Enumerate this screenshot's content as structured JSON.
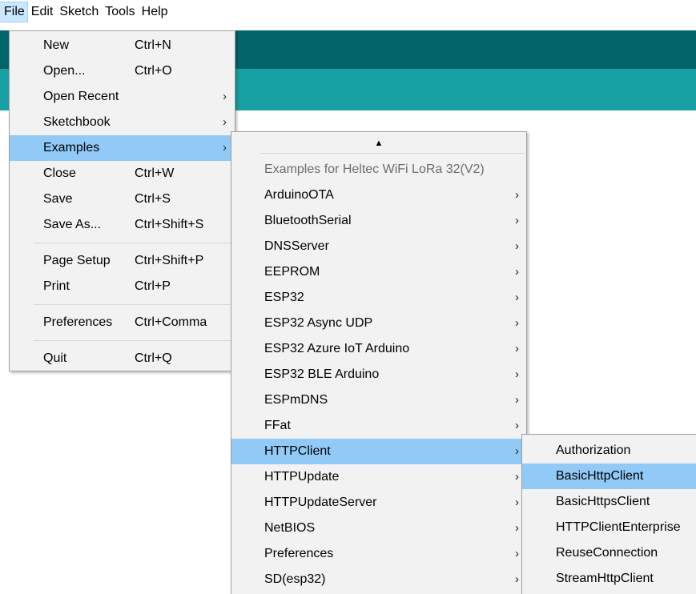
{
  "menubar": {
    "items": [
      "File",
      "Edit",
      "Sketch",
      "Tools",
      "Help"
    ]
  },
  "file_menu": {
    "items": [
      {
        "label": "New",
        "shortcut": "Ctrl+N",
        "arrow": ""
      },
      {
        "label": "Open...",
        "shortcut": "Ctrl+O",
        "arrow": ""
      },
      {
        "label": "Open Recent",
        "shortcut": "",
        "arrow": "›"
      },
      {
        "label": "Sketchbook",
        "shortcut": "",
        "arrow": "›"
      },
      {
        "label": "Examples",
        "shortcut": "",
        "arrow": "›"
      },
      {
        "label": "Close",
        "shortcut": "Ctrl+W",
        "arrow": ""
      },
      {
        "label": "Save",
        "shortcut": "Ctrl+S",
        "arrow": ""
      },
      {
        "label": "Save As...",
        "shortcut": "Ctrl+Shift+S",
        "arrow": ""
      },
      {
        "label": "Page Setup",
        "shortcut": "Ctrl+Shift+P",
        "arrow": ""
      },
      {
        "label": "Print",
        "shortcut": "Ctrl+P",
        "arrow": ""
      },
      {
        "label": "Preferences",
        "shortcut": "Ctrl+Comma",
        "arrow": ""
      },
      {
        "label": "Quit",
        "shortcut": "Ctrl+Q",
        "arrow": ""
      }
    ]
  },
  "examples_menu": {
    "scroll_up": "▲",
    "header": "Examples for Heltec WiFi LoRa 32(V2)",
    "items": [
      {
        "label": "ArduinoOTA",
        "arrow": "›"
      },
      {
        "label": "BluetoothSerial",
        "arrow": "›"
      },
      {
        "label": "DNSServer",
        "arrow": "›"
      },
      {
        "label": "EEPROM",
        "arrow": "›"
      },
      {
        "label": "ESP32",
        "arrow": "›"
      },
      {
        "label": "ESP32 Async UDP",
        "arrow": "›"
      },
      {
        "label": "ESP32 Azure IoT Arduino",
        "arrow": "›"
      },
      {
        "label": "ESP32 BLE Arduino",
        "arrow": "›"
      },
      {
        "label": "ESPmDNS",
        "arrow": "›"
      },
      {
        "label": "FFat",
        "arrow": "›"
      },
      {
        "label": "HTTPClient",
        "arrow": "›"
      },
      {
        "label": "HTTPUpdate",
        "arrow": "›"
      },
      {
        "label": "HTTPUpdateServer",
        "arrow": "›"
      },
      {
        "label": "NetBIOS",
        "arrow": "›"
      },
      {
        "label": "Preferences",
        "arrow": "›"
      },
      {
        "label": "SD(esp32)",
        "arrow": "›"
      }
    ]
  },
  "httpclient_menu": {
    "items": [
      "Authorization",
      "BasicHttpClient",
      "BasicHttpsClient",
      "HTTPClientEnterprise",
      "ReuseConnection",
      "StreamHttpClient"
    ]
  },
  "colors": {
    "toolbar_dark": "#006468",
    "toolbar_light": "#17a1a5",
    "highlight": "#91c9f7",
    "menu_bg": "#f2f2f2"
  }
}
